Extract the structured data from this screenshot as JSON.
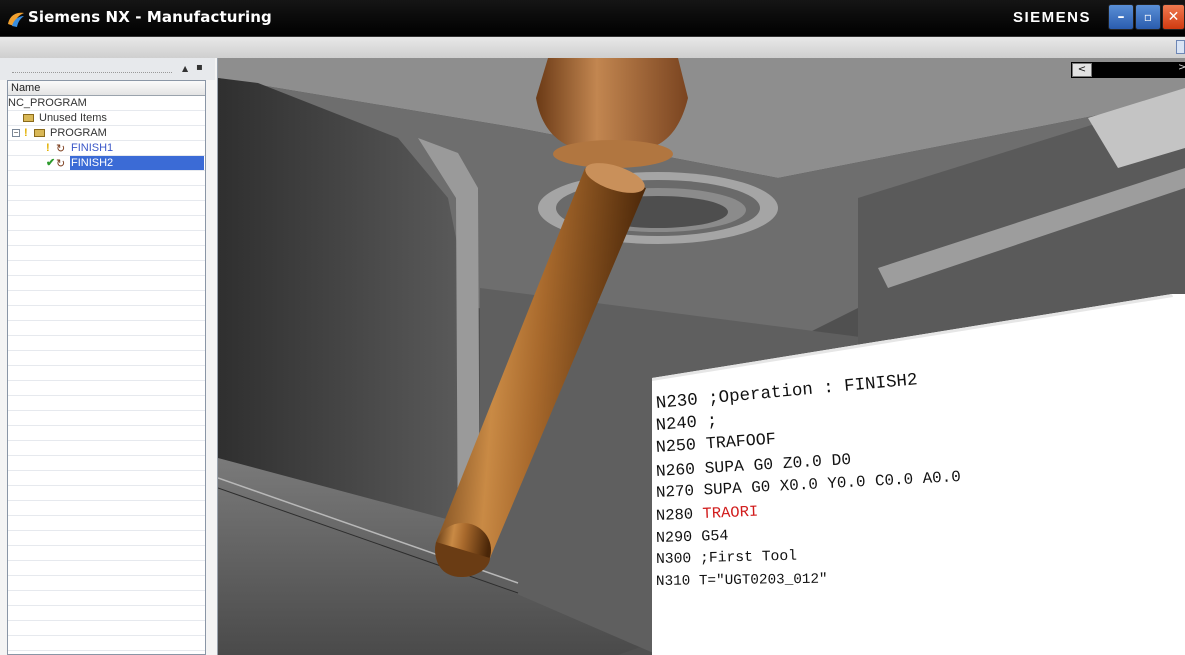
{
  "window": {
    "title": "Siemens NX - Manufacturing",
    "brand": "SIEMENS",
    "controls": {
      "minimize": "–",
      "maximize": "▫",
      "close": "✕"
    }
  },
  "navigator": {
    "column_header": "Name",
    "tree": [
      {
        "label": "NC_PROGRAM",
        "level": 0,
        "style": "root"
      },
      {
        "label": "Unused Items",
        "level": 1,
        "icon": "folder-icon"
      },
      {
        "label": "PROGRAM",
        "level": 1,
        "icon": "folder-icon",
        "expander": "−",
        "status": "!"
      },
      {
        "label": "FINISH1",
        "level": 2,
        "icon": "operation-icon",
        "status": "!",
        "style": "link"
      },
      {
        "label": "FINISH2",
        "level": 2,
        "icon": "operation-icon",
        "status": "✔",
        "style": "selected"
      }
    ]
  },
  "viewport": {
    "scroll_left": "<",
    "scroll_right": ">"
  },
  "nc_code": [
    {
      "n": "N230",
      "code": ";Operation : FINISH2"
    },
    {
      "n": "N240",
      "code": ";"
    },
    {
      "n": "N250",
      "code": "TRAFOOF"
    },
    {
      "n": "N260",
      "code": "SUPA G0 Z0.0 D0"
    },
    {
      "n": "N270",
      "code": "SUPA G0 X0.0 Y0.0 C0.0 A0.0"
    },
    {
      "n": "N280",
      "code": "TRAORI",
      "highlight": true
    },
    {
      "n": "N290",
      "code": "G54"
    },
    {
      "n": "N300",
      "code": ";First Tool"
    },
    {
      "n": "N310",
      "code": "T=\"UGT0203_012\""
    }
  ],
  "colors": {
    "selection": "#3b6bd6",
    "link": "#3a57c8",
    "highlight_code": "#d11b1b",
    "tool": "#a8692c"
  }
}
